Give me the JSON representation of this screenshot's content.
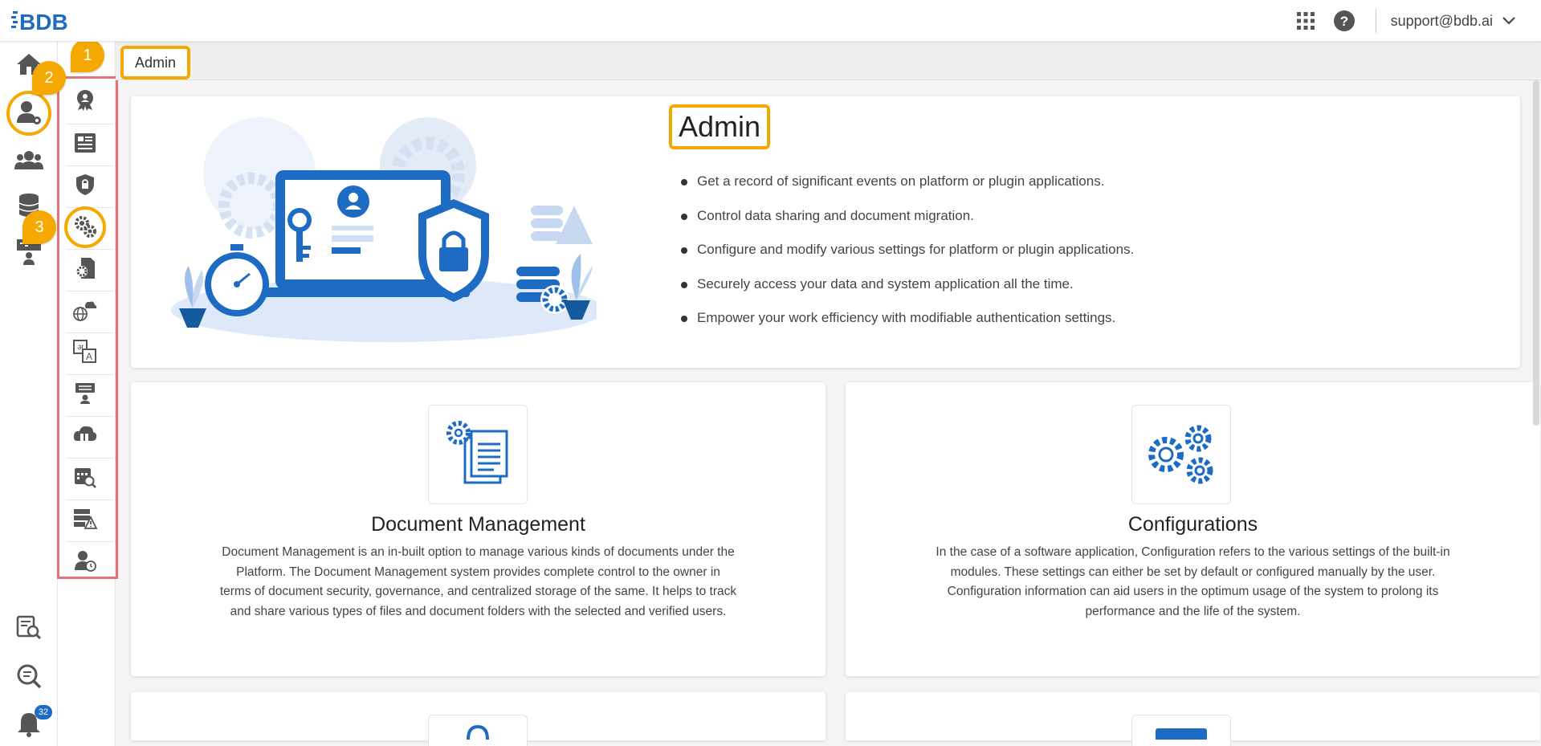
{
  "header": {
    "logo_text": "BDB",
    "user_email": "support@bdb.ai",
    "icons": [
      "apps-grid-icon",
      "help-icon",
      "chevron-down-icon"
    ]
  },
  "rail": {
    "items": [
      "home-icon",
      "admin-user-gear-icon",
      "users-group-icon",
      "database-icon",
      "dashboard-presenter-icon",
      "data-search-icon",
      "search-icon",
      "bell-icon"
    ],
    "notification_count": "32"
  },
  "submenu": {
    "items": [
      "audit-badge-icon",
      "document-management-icon",
      "security-shield-icon",
      "configurations-gears-icon",
      "file-settings-icon",
      "globe-cloud-icon",
      "language-translate-icon",
      "presenter-icon",
      "cloud-server-icon",
      "calendar-search-icon",
      "server-warning-icon",
      "user-clock-icon"
    ]
  },
  "breadcrumb": {
    "label": "Admin"
  },
  "steps": [
    "1",
    "2",
    "3"
  ],
  "hero": {
    "title": "Admin",
    "bullets": [
      "Get a record of significant events on platform or plugin applications.",
      "Control data sharing and document migration.",
      "Configure and modify various settings for platform or plugin applications.",
      "Securely access your data and system application all the time.",
      "Empower your work efficiency with modifiable authentication settings."
    ]
  },
  "cards": [
    {
      "title": "Document Management",
      "description": "Document Management is an in-built option to manage various kinds of documents under the Platform. The Document Management system provides complete control to the owner in terms of document security, governance, and centralized storage of the same. It helps to track and share various types of files and document folders with the selected and verified users."
    },
    {
      "title": "Configurations",
      "description": "In the case of a software application, Configuration refers to the various settings of the built-in modules. These settings can either be set by default or configured manually by the user. Configuration information can aid users in the optimum usage of the system to prolong its performance and the life of the system."
    }
  ],
  "colors": {
    "accent": "#f5a800",
    "primary_blue": "#1e6bc4",
    "highlight_red": "#e57373"
  }
}
